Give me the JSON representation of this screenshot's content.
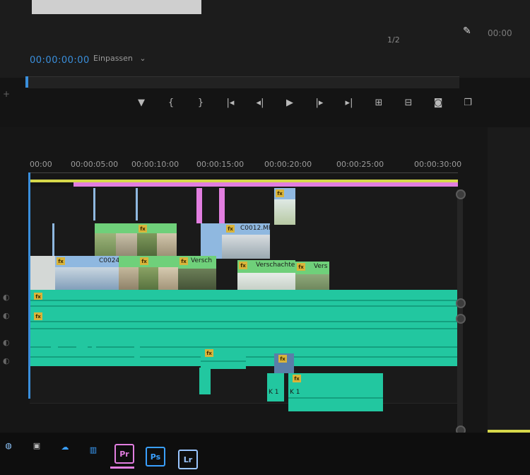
{
  "monitor": {
    "timecode": "00:00:00:00",
    "fit_label": "Einpassen",
    "zoom_ratio": "1/2",
    "timecode_right": "00:00"
  },
  "transport": [
    {
      "icon": "marker-icon",
      "glyph": "▼"
    },
    {
      "icon": "mark-in-icon",
      "glyph": "{"
    },
    {
      "icon": "mark-out-icon",
      "glyph": "}"
    },
    {
      "icon": "go-to-in-icon",
      "glyph": "|◂"
    },
    {
      "icon": "step-back-icon",
      "glyph": "◂|"
    },
    {
      "icon": "play-icon",
      "glyph": "▶"
    },
    {
      "icon": "step-forward-icon",
      "glyph": "|▸"
    },
    {
      "icon": "go-to-out-icon",
      "glyph": "▸|"
    },
    {
      "icon": "insert-icon",
      "glyph": "⊞"
    },
    {
      "icon": "overwrite-icon",
      "glyph": "⊟"
    },
    {
      "icon": "export-frame-icon",
      "glyph": "◙"
    },
    {
      "icon": "compare-icon",
      "glyph": "❐"
    }
  ],
  "ruler": {
    "ticks": [
      "00:00",
      "00:00:05:00",
      "00:00:10:00",
      "00:00:15:00",
      "00:00:20:00",
      "00:00:25:00",
      "00:00:30:00"
    ]
  },
  "clips": {
    "v2_clip": "C0012.MP",
    "v1_clip1": "C0024",
    "v1_clip2": "Versch",
    "v1_clip3": "Verschachtel",
    "v1_clip4": "Vers",
    "audio_k1a": "K 1",
    "audio_k1b": "K 1",
    "fx_label": "fx"
  },
  "taskbar": {
    "apps": [
      {
        "name": "pr",
        "label": "Pr",
        "color": "#e27ee0"
      },
      {
        "name": "ps",
        "label": "Ps",
        "color": "#3aa0ff"
      },
      {
        "name": "lr",
        "label": "Lr",
        "color": "#9ac6ff"
      }
    ]
  },
  "colors": {
    "accent_blue": "#3a8fdc",
    "clip_green": "#6fd07a",
    "clip_blue": "#8fb8e0",
    "audio_teal": "#22c7a0",
    "work_area_yellow": "#d6d84a",
    "work_area_pink": "#e27ee0"
  }
}
